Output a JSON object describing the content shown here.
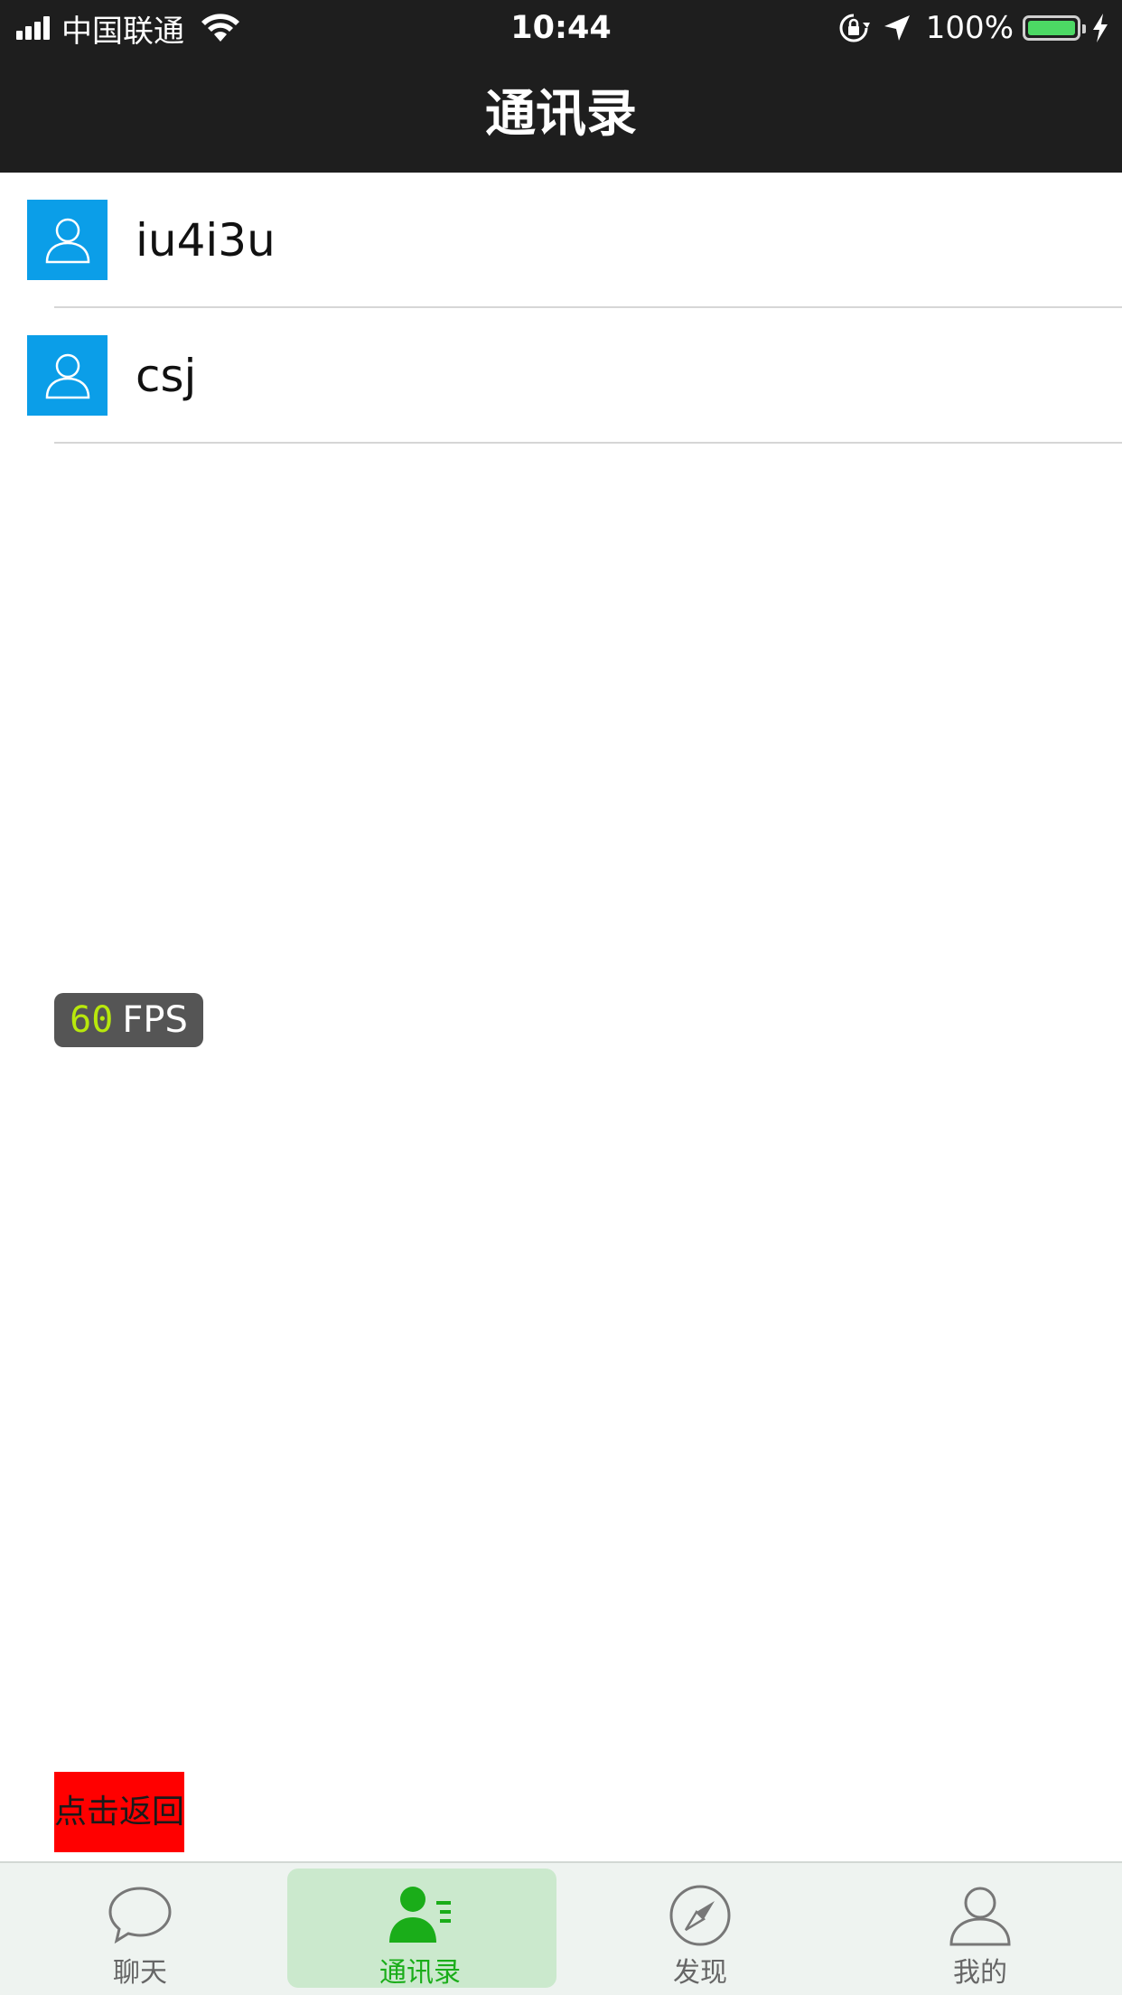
{
  "status_bar": {
    "carrier": "中国联通",
    "time": "10:44",
    "battery": "100%"
  },
  "nav": {
    "title": "通讯录"
  },
  "contacts": [
    {
      "name": "iu4i3u"
    },
    {
      "name": "csj"
    }
  ],
  "fps_badge": {
    "value": "60",
    "unit": "FPS"
  },
  "back_button": {
    "label": "点击返回"
  },
  "tabbar": {
    "tabs": [
      {
        "label": "聊天",
        "icon": "chat-bubble-icon",
        "active": false
      },
      {
        "label": "通讯录",
        "icon": "contacts-icon",
        "active": true
      },
      {
        "label": "发现",
        "icon": "compass-icon",
        "active": false
      },
      {
        "label": "我的",
        "icon": "person-icon",
        "active": false
      }
    ]
  },
  "colors": {
    "header_bg": "#1e1e1e",
    "avatar_bg": "#0b9ee8",
    "active_tab": "#1aad19",
    "active_tab_bg": "#cbe9cd",
    "back_button_bg": "#ff0000",
    "fps_value": "#b8e80c"
  }
}
